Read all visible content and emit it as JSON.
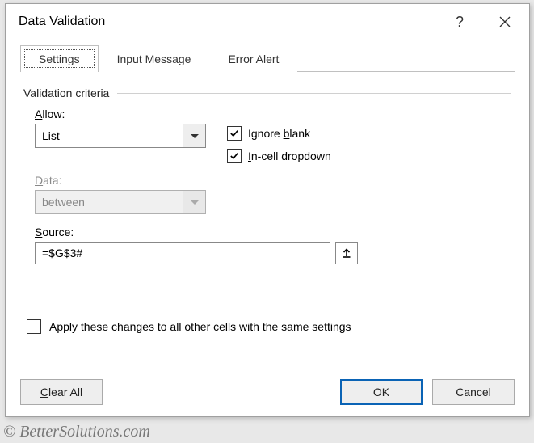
{
  "title": "Data Validation",
  "tabs": {
    "settings": "Settings",
    "input_message": "Input Message",
    "error_alert": "Error Alert"
  },
  "criteria": {
    "legend": "Validation criteria",
    "allow_label_pre": "A",
    "allow_label_post": "llow:",
    "allow_value": "List",
    "data_label_pre": "D",
    "data_label_post": "ata:",
    "data_value": "between",
    "ignore_blank_pre": "Ignore ",
    "ignore_blank_u": "b",
    "ignore_blank_post": "lank",
    "ignore_blank_checked": true,
    "in_cell_pre": "I",
    "in_cell_post": "n-cell dropdown",
    "in_cell_checked": true,
    "source_label_pre": "S",
    "source_label_post": "ource:",
    "source_value": "=$G$3#",
    "apply_label_pre": "Apply these changes to all other cells with the same settings",
    "apply_checked": false
  },
  "buttons": {
    "clear_all_pre": "C",
    "clear_all_post": "lear All",
    "ok": "OK",
    "cancel": "Cancel"
  },
  "watermark": "© BetterSolutions.com"
}
